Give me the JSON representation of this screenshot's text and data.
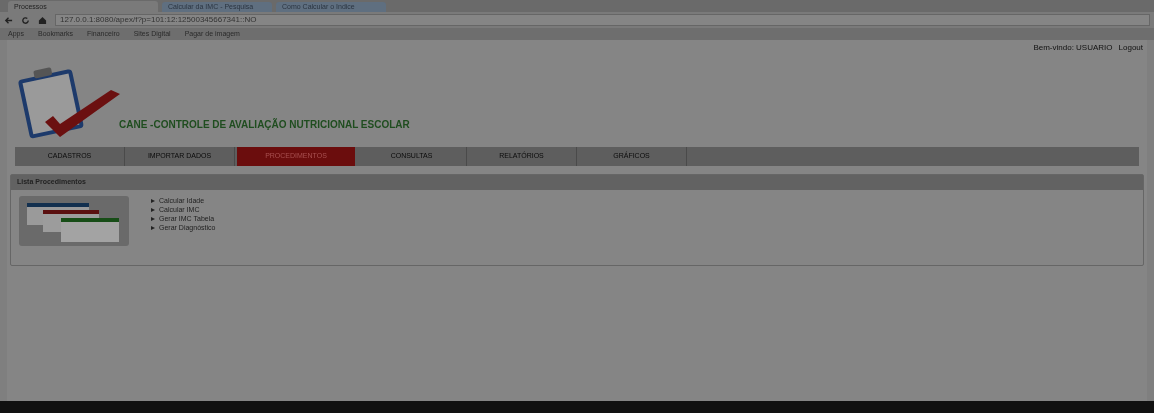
{
  "browser": {
    "tabs": [
      {
        "label": "Processos",
        "selected": true
      },
      {
        "label": "Calcular da IMC - Pesquisa",
        "selected": false
      },
      {
        "label": "Como Calcular o Indice",
        "selected": false
      }
    ],
    "address": "127.0.0.1:8080/apex/f?p=101:12:12500345667341::NO",
    "bookmarks": [
      "Apps",
      "Bookmarks",
      "Financeiro",
      "Sites Digital",
      "Pagar de imagem"
    ]
  },
  "header": {
    "welcome": "Bem-vindo: USUARIO",
    "logout": "Logout",
    "title": "CANE -CONTROLE DE AVALIAÇÃO NUTRICIONAL ESCOLAR"
  },
  "menu": [
    {
      "label": "CADASTROS",
      "selected": false
    },
    {
      "label": "IMPORTAR DADOS",
      "selected": false
    },
    {
      "label": "PROCEDIMENTOS",
      "selected": true
    },
    {
      "label": "CONSULTAS",
      "selected": false
    },
    {
      "label": "RELATÓRIOS",
      "selected": false
    },
    {
      "label": "GRÁFICOS",
      "selected": false
    }
  ],
  "panel": {
    "title": "Lista Procedimentos",
    "items": [
      "Calcular Idade",
      "Calcular IMC",
      "Gerar IMC Tabela",
      "Gerar Diagnóstico"
    ]
  }
}
